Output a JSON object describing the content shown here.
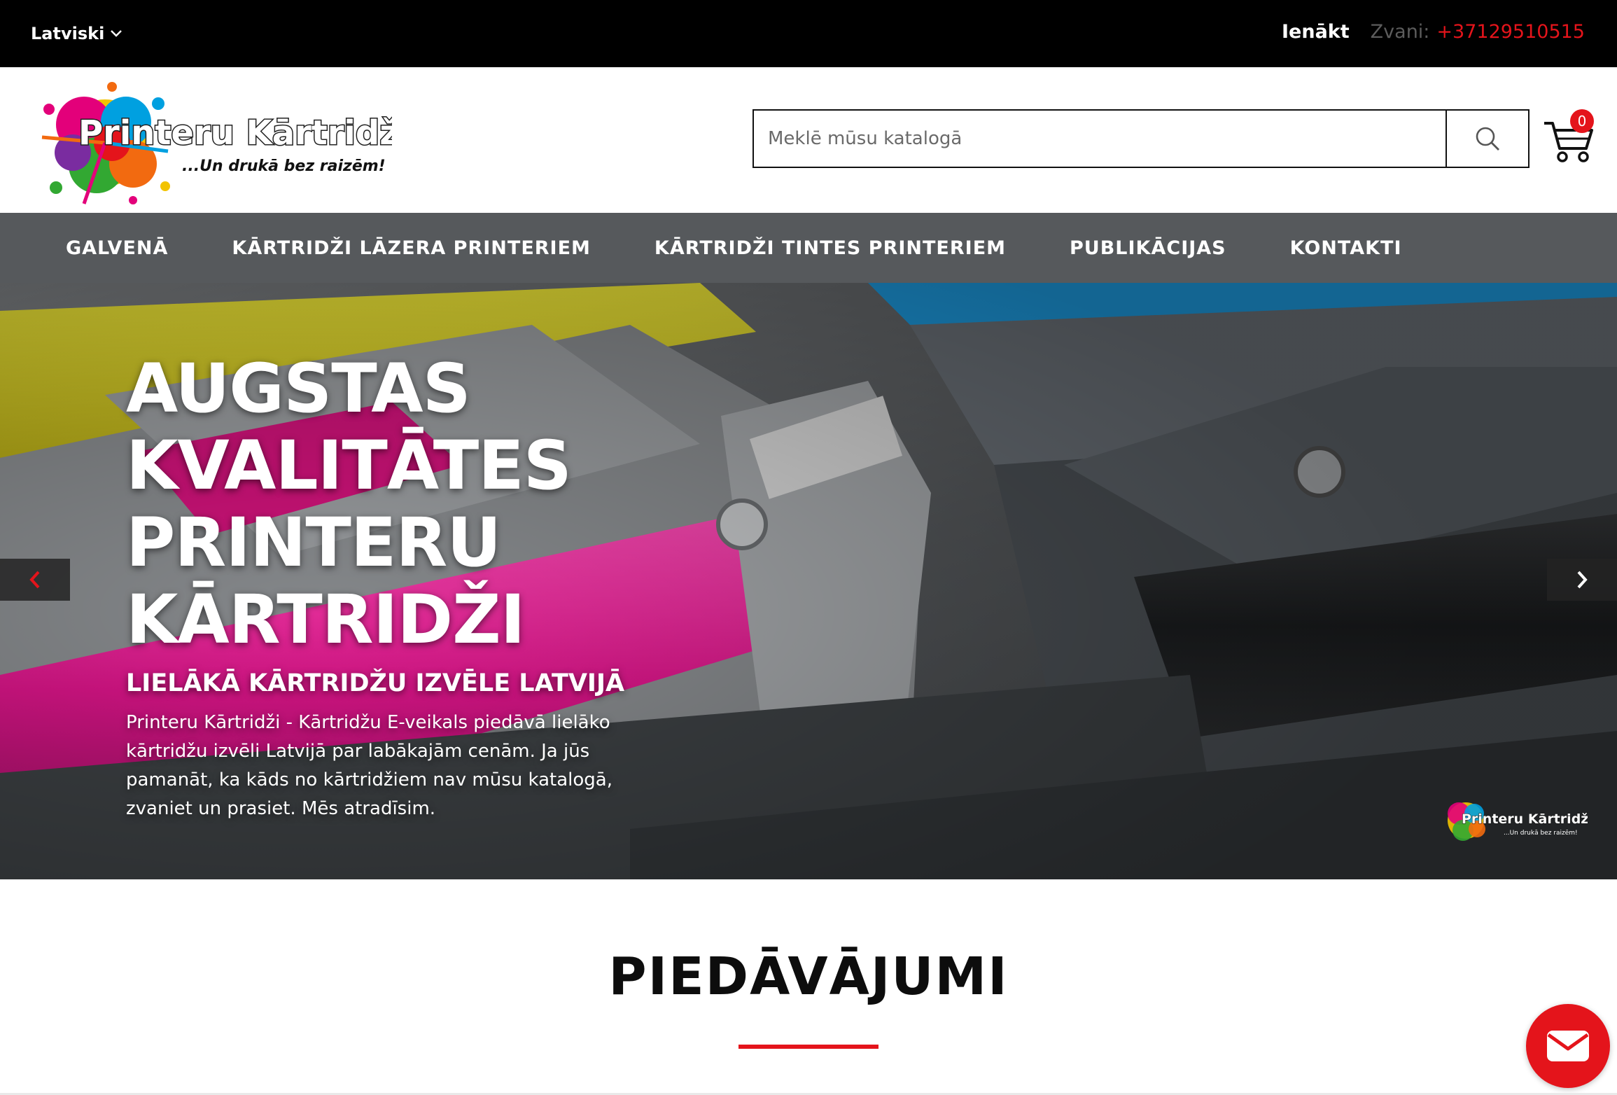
{
  "topbar": {
    "language": "Latviski",
    "login": "Ienākt",
    "call_label": "Zvani:",
    "phone": "+37129510515"
  },
  "header": {
    "logo_title": "Printeru Kārtridži",
    "logo_tagline": "...Un drukā bez raizēm!",
    "search_placeholder": "Meklē mūsu katalogā",
    "cart_count": "0"
  },
  "nav": {
    "items": [
      {
        "label": "GALVENĀ"
      },
      {
        "label": "KĀRTRIDŽI LĀZERA PRINTERIEM"
      },
      {
        "label": "KĀRTRIDŽI TINTES PRINTERIEM"
      },
      {
        "label": "PUBLIKĀCIJAS"
      },
      {
        "label": "KONTAKTI"
      }
    ]
  },
  "hero": {
    "title": "AUGSTAS\nKVALITĀTES\nPRINTERU\nKĀRTRIDŽI",
    "subtitle": "LIELĀKĀ KĀRTRIDŽU IZVĒLE LATVIJĀ",
    "description": "Printeru Kārtridži - Kārtridžu E-veikals piedāvā lielāko kārtridžu izvēli Latvijā par labākajām cenām. Ja jūs pamanāt, ka kāds no kārtridžiem nav mūsu katalogā, zvaniet un prasiet. Mēs atradīsim.",
    "watermark_title": "Printeru Kārtridži",
    "watermark_tagline": "...Un drukā bez raizēm!"
  },
  "offers": {
    "title": "PIEDĀVĀJUMI"
  },
  "icons": {
    "language": "chevron-down-icon",
    "search": "search-icon",
    "cart": "cart-icon",
    "prev": "chevron-left-icon",
    "next": "chevron-right-icon",
    "chat": "mail-icon"
  },
  "colors": {
    "accent": "#e4141b",
    "topbar": "#000000",
    "nav": "#56595c",
    "call_label": "#5c5c5c"
  }
}
